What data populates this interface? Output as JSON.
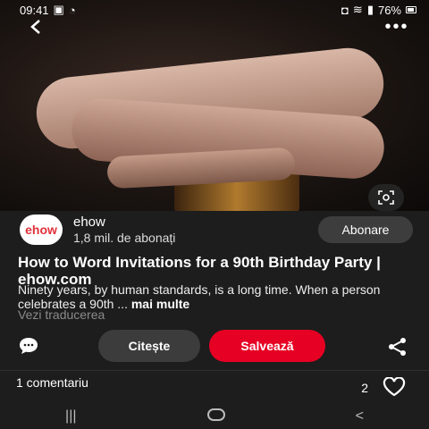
{
  "status": {
    "time": "09:41",
    "battery": "76%"
  },
  "icons": {
    "back": "back-arrow-icon",
    "more": "more-options-icon",
    "lens": "visual-search-icon",
    "comment": "comment-icon",
    "share": "share-icon",
    "heart": "heart-icon"
  },
  "creator": {
    "avatar_text": "ehow",
    "name": "ehow",
    "subscribers": "1,8 mil. de abonați",
    "follow_label": "Abonare"
  },
  "pin": {
    "title": "How to Word Invitations for a 90th Birthday Party | ehow.com",
    "description": "Ninety years, by human standards, is a long time. When a person celebrates a 90th ...",
    "more_label": "mai multe",
    "translate_label": "Vezi traducerea"
  },
  "actions": {
    "read_label": "Citește",
    "save_label": "Salvează"
  },
  "comments": {
    "label": "1 comentariu",
    "likes": "2"
  },
  "colors": {
    "accent": "#e60023",
    "panel": "#1d1d1d"
  }
}
